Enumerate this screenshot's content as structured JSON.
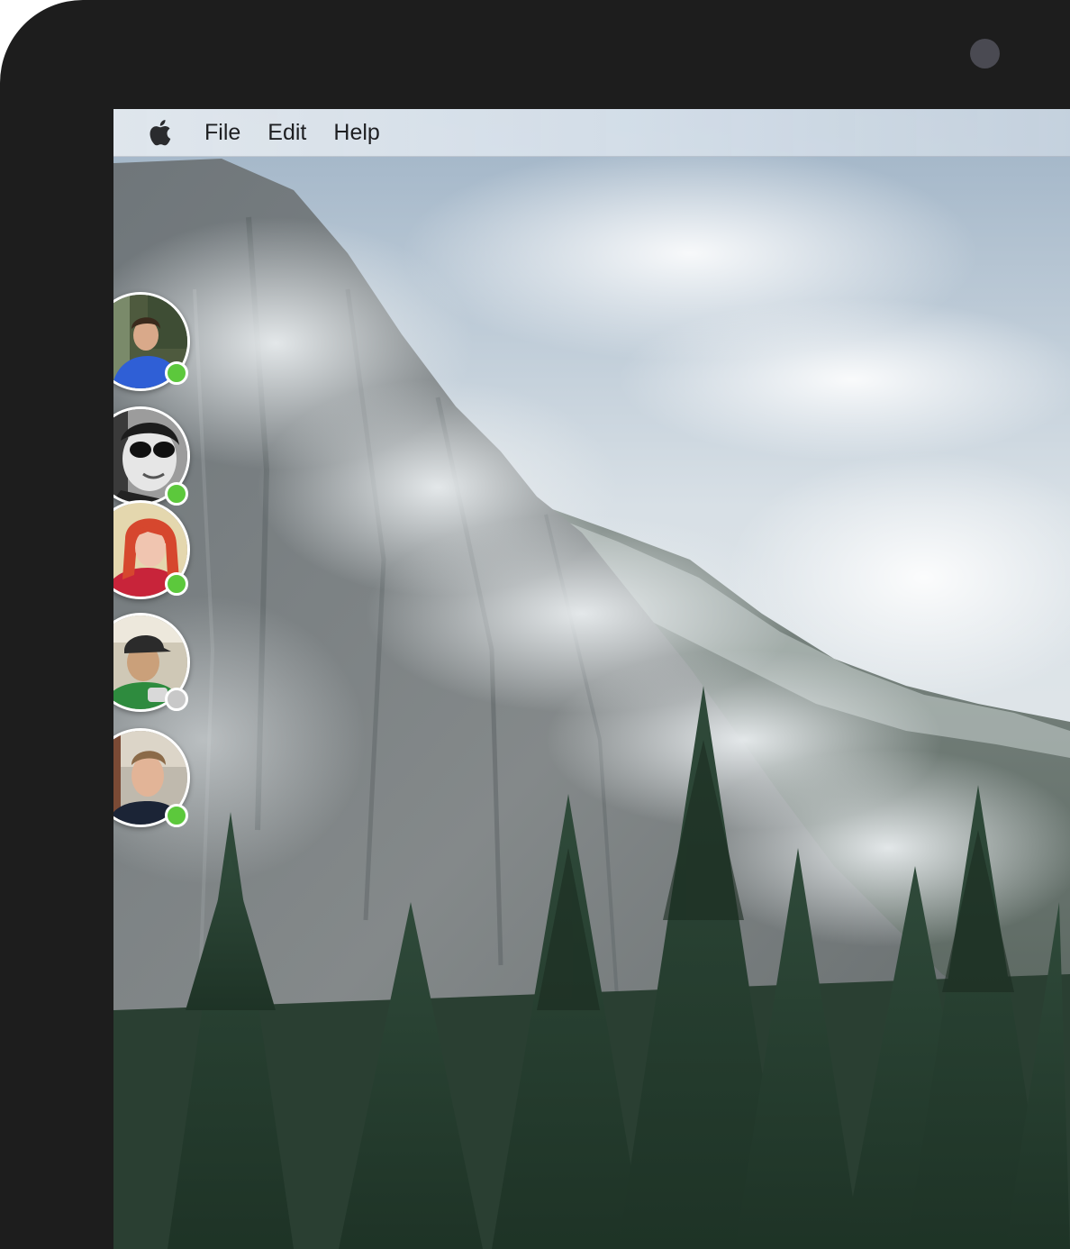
{
  "menubar": {
    "apple_icon": "apple-logo-icon",
    "items": [
      {
        "label": "File"
      },
      {
        "label": "Edit"
      },
      {
        "label": "Help"
      }
    ]
  },
  "contacts": [
    {
      "status": "online",
      "status_color": "#5cc83c"
    },
    {
      "status": "online",
      "status_color": "#5cc83c"
    },
    {
      "status": "online",
      "status_color": "#5cc83c"
    },
    {
      "status": "offline",
      "status_color": "#c8c8c8"
    },
    {
      "status": "online",
      "status_color": "#5cc83c"
    }
  ],
  "colors": {
    "bezel": "#1d1d1d",
    "camera": "#4a4a52",
    "online": "#5cc83c",
    "offline": "#c8c8c8"
  }
}
